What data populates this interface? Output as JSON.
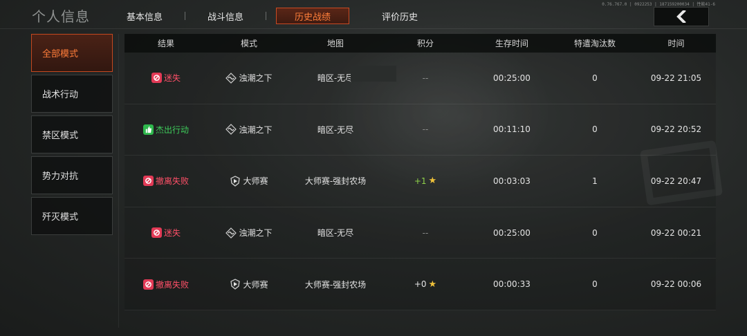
{
  "header": {
    "title": "个人信息",
    "tabs": [
      {
        "label": "基本信息",
        "active": false
      },
      {
        "label": "战斗信息",
        "active": false
      },
      {
        "label": "历史战绩",
        "active": true
      },
      {
        "label": "评价历史",
        "active": false
      }
    ],
    "status_text": "0.76.767.0 | 0922253 | 187159200034 | 性能41-6",
    "back_icon": "chevron-left-icon"
  },
  "sidebar": {
    "items": [
      {
        "label": "全部模式",
        "active": true
      },
      {
        "label": "战术行动",
        "active": false
      },
      {
        "label": "禁区模式",
        "active": false
      },
      {
        "label": "势力对抗",
        "active": false
      },
      {
        "label": "歼灭模式",
        "active": false
      }
    ]
  },
  "table": {
    "columns": [
      "结果",
      "模式",
      "地图",
      "积分",
      "生存时间",
      "特遣淘汰数",
      "时间"
    ],
    "rows": [
      {
        "result": "迷失",
        "result_type": "fail",
        "mode": "浊潮之下",
        "mode_icon": "wave-emblem-icon",
        "map": "暗区-无尽",
        "score": "--",
        "score_type": "dash",
        "survival": "00:25:00",
        "eliminations": "0",
        "time": "09-22 21:05"
      },
      {
        "result": "杰出行动",
        "result_type": "win",
        "mode": "浊潮之下",
        "mode_icon": "wave-emblem-icon",
        "map": "暗区-无尽",
        "score": "--",
        "score_type": "dash",
        "survival": "00:11:10",
        "eliminations": "0",
        "time": "09-22 20:52"
      },
      {
        "result": "撤离失败",
        "result_type": "fail",
        "mode": "大师赛",
        "mode_icon": "master-shield-icon",
        "map": "大师赛-强封农场",
        "score": "+1",
        "score_type": "plus",
        "survival": "00:03:03",
        "eliminations": "1",
        "time": "09-22 20:47"
      },
      {
        "result": "迷失",
        "result_type": "fail",
        "mode": "浊潮之下",
        "mode_icon": "wave-emblem-icon",
        "map": "暗区-无尽",
        "score": "--",
        "score_type": "dash",
        "survival": "00:25:00",
        "eliminations": "0",
        "time": "09-22 00:21"
      },
      {
        "result": "撤离失败",
        "result_type": "fail",
        "mode": "大师赛",
        "mode_icon": "master-shield-icon",
        "map": "大师赛-强封农场",
        "score": "+0",
        "score_type": "neutral",
        "survival": "00:00:33",
        "eliminations": "0",
        "time": "09-22 00:06"
      }
    ]
  },
  "colors": {
    "accent": "#ff7d3a",
    "fail": "#ff5068",
    "win": "#3ecd5b",
    "star": "#f0c23a",
    "score_plus": "#8fd14a"
  }
}
